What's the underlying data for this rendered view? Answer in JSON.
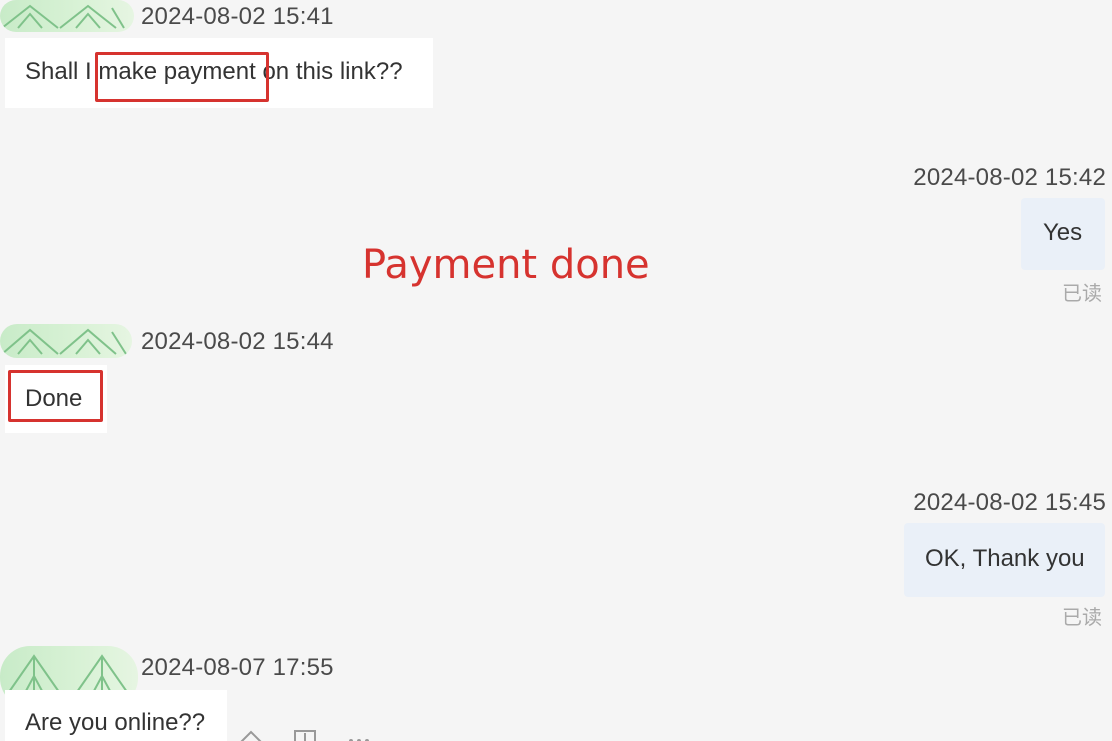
{
  "messages": [
    {
      "timestamp": "2024-08-02 15:41",
      "parts": [
        "Shall I ",
        "make payment",
        " on this link??"
      ]
    },
    {
      "timestamp": "2024-08-02 15:42",
      "text": "Yes",
      "status": "已读"
    },
    {
      "timestamp": "2024-08-02 15:44",
      "text": "Done"
    },
    {
      "timestamp": "2024-08-02 15:45",
      "text": "OK, Thank you",
      "status": "已读"
    },
    {
      "timestamp": "2024-08-07 17:55",
      "text": "Are you online??"
    }
  ],
  "annotation": "Payment done",
  "colors": {
    "highlight": "#d6332f",
    "background": "#f5f5f5",
    "incoming_bubble": "#ffffff",
    "outgoing_bubble": "#eaf0f8",
    "avatar": "#c8ebc8"
  },
  "icons": [
    "leaf-avatar-icon",
    "share-icon",
    "translate-icon",
    "more-icon"
  ]
}
